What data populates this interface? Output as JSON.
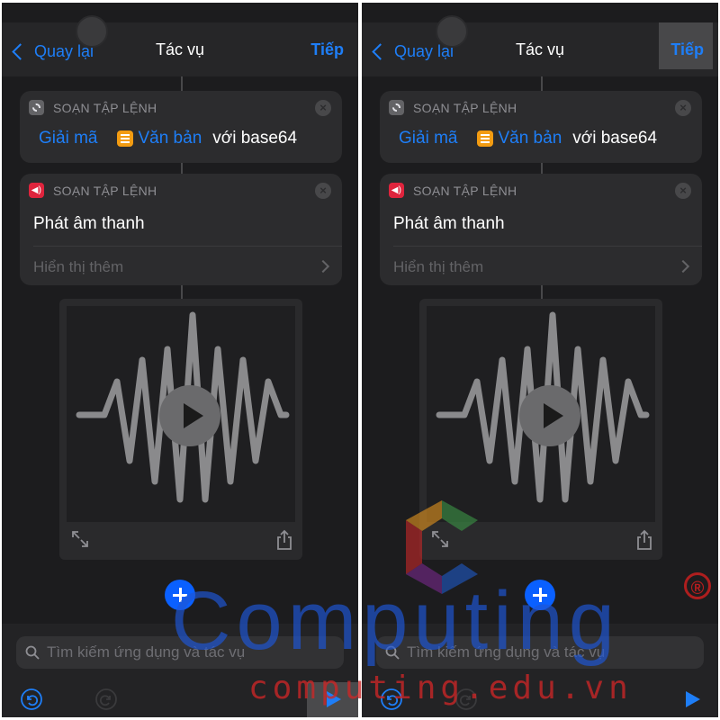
{
  "colors": {
    "background": "#1c1c1e",
    "accent": "#1e7ef7",
    "card": "#2c2c2e",
    "add_button": "#0a60ff",
    "text_icon": "#f39c12",
    "sound_icon": "#e0243d",
    "watermark_blue": "#1d56d6",
    "watermark_red": "#cd2626"
  },
  "screens": [
    {
      "nav": {
        "back_label": "Quay lại",
        "title": "Tác vụ",
        "next_label": "Tiếp",
        "next_highlighted": false
      },
      "decode_card": {
        "header": "SOẠN TẬP LỆNH",
        "icon": "gear-icon",
        "verb": "Giải mã",
        "variable": "Văn bản",
        "suffix": "với base64"
      },
      "sound_card": {
        "header": "SOẠN TẬP LỆNH",
        "icon": "speaker-icon",
        "title": "Phát âm thanh",
        "more": "Hiển thị thêm"
      },
      "search_placeholder": "Tìm kiếm ứng dụng và tác vụ",
      "run_highlighted": true
    },
    {
      "nav": {
        "back_label": "Quay lại",
        "title": "Tác vụ",
        "next_label": "Tiếp",
        "next_highlighted": true
      },
      "decode_card": {
        "header": "SOẠN TẬP LỆNH",
        "icon": "gear-icon",
        "verb": "Giải mã",
        "variable": "Văn bản",
        "suffix": "với base64"
      },
      "sound_card": {
        "header": "SOẠN TẬP LỆNH",
        "icon": "speaker-icon",
        "title": "Phát âm thanh",
        "more": "Hiển thị thêm"
      },
      "search_placeholder": "Tìm kiếm ứng dụng và tác vụ",
      "run_highlighted": false
    }
  ],
  "watermark": {
    "brand": "Computing",
    "url": "computing.edu.vn",
    "registered": "®"
  }
}
